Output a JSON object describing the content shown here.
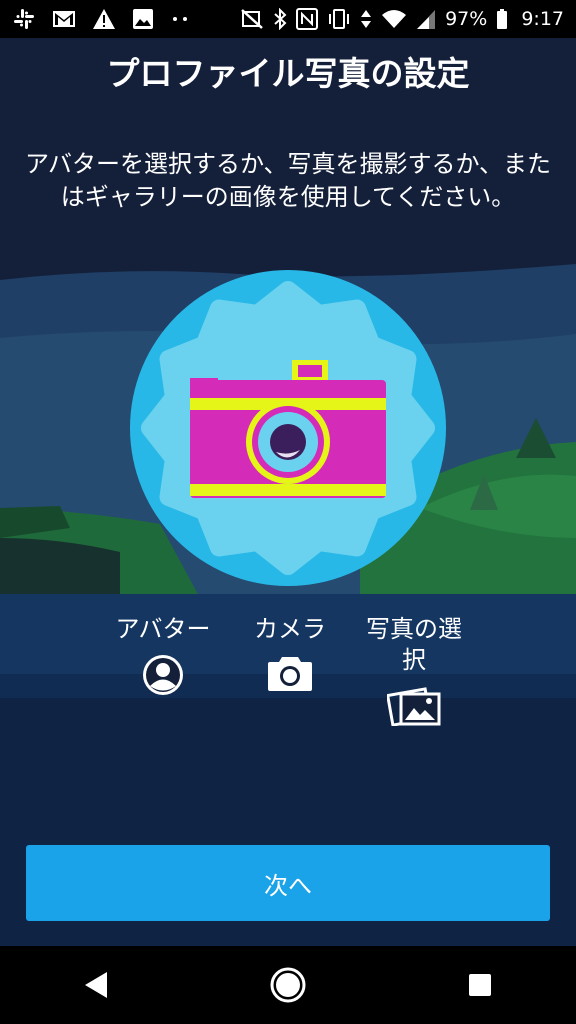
{
  "status_bar": {
    "battery": "97%",
    "time": "9:17",
    "icons": [
      "slack-icon",
      "gmail-icon",
      "warning-icon",
      "image-icon",
      "more-dots-icon",
      "signal-off-icon",
      "bluetooth-icon",
      "nfc-icon",
      "vibrate-icon",
      "data-arrows-icon",
      "wifi-icon",
      "cell-signal-icon"
    ]
  },
  "header": {
    "title": "プロファイル写真の設定",
    "subtitle": "アバターを選択するか、写真を撮影するか、またはギャラリーの画像を使用してください。"
  },
  "options": {
    "avatar": {
      "label": "アバター",
      "icon": "account-circle-icon"
    },
    "camera": {
      "label": "カメラ",
      "icon": "camera-icon"
    },
    "gallery": {
      "label": "写真の選択",
      "icon": "photo-library-icon"
    }
  },
  "next_button": {
    "label": "次へ"
  },
  "nav_bar": {
    "icons": [
      "back-icon",
      "home-icon",
      "recents-icon"
    ]
  },
  "colors": {
    "accent": "#1aa3e8",
    "sky": "#14203a",
    "gear_circle": "#28b8e8",
    "gear": "#6ad2ee",
    "camera_body": "#d42bb8",
    "camera_stripe": "#e6f518"
  }
}
